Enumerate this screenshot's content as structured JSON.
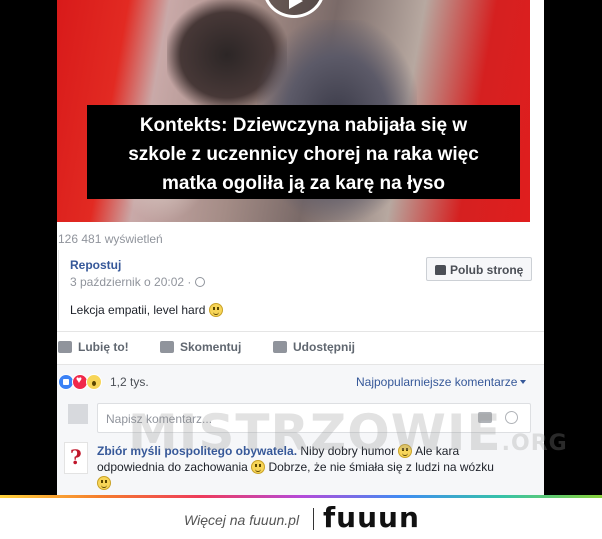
{
  "video": {
    "caption_line1": "Kontekts: Dziewczyna nabijała się w",
    "caption_line2": "szkole z uczennicy chorej na raka więc",
    "caption_line3": "matka ogoliła ją za karę na łyso"
  },
  "stats": {
    "views": "126 481 wyświetleń"
  },
  "shared_post": {
    "author": "Repostuj",
    "date": "3 październik o 20:02 ·",
    "text": "Lekcja empatii, level hard",
    "like_page_label": "Polub stronę"
  },
  "actions": {
    "like": "Lubię to!",
    "comment": "Skomentuj",
    "share": "Udostępnij"
  },
  "reactions": {
    "count": "1,2 tys.",
    "sort_label": "Najpopularniejsze komentarze",
    "icons": [
      "like-icon",
      "love-icon",
      "wow-icon"
    ]
  },
  "comment_input": {
    "placeholder": "Napisz komentarz..."
  },
  "comment": {
    "author": "Zbiór myśli pospolitego obywatela.",
    "text1": "Niby dobry humor",
    "text2": "Ale kara odpowiednia do zachowania",
    "text3": "Dobrze, że nie śmiała się z ludzi na wózku"
  },
  "watermark": {
    "main": "MISTRZOWIE",
    "suffix": ".ORG"
  },
  "footer": {
    "more_link": "Więcej na fuuun.pl",
    "logo": "fuuun"
  },
  "colors": {
    "link": "#365899",
    "page_bg": "#000000",
    "video_red": "#e01e1e"
  }
}
